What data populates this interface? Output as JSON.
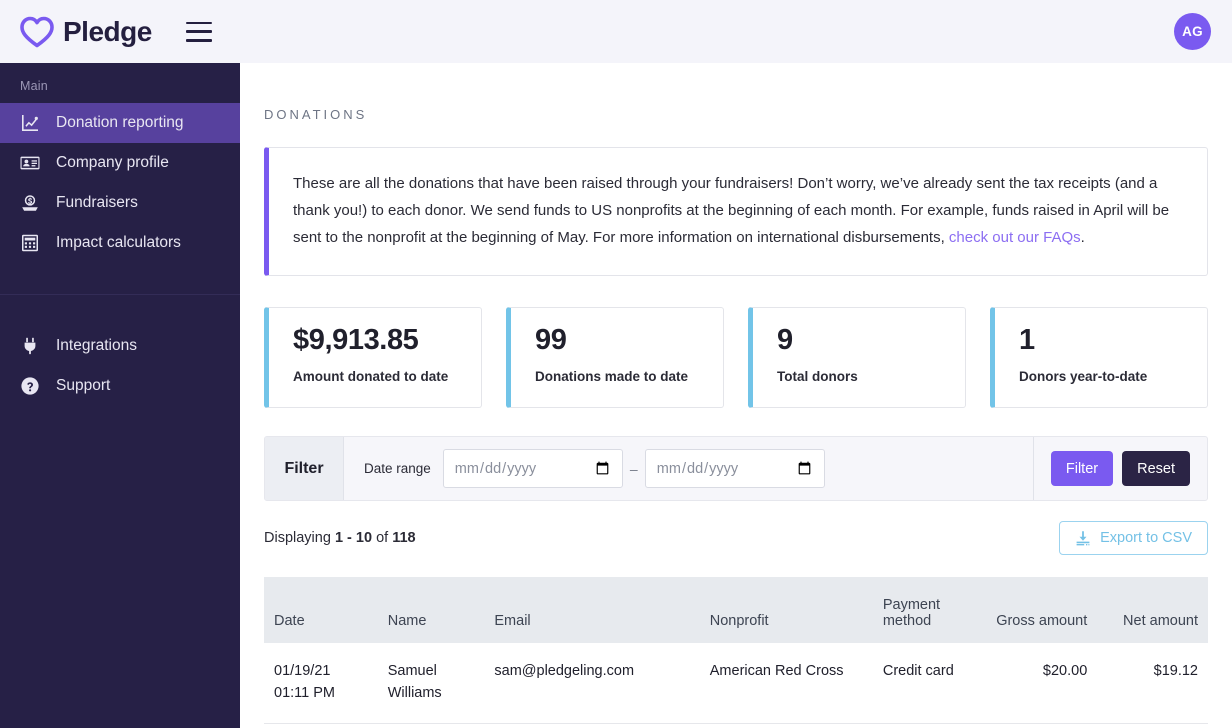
{
  "header": {
    "brand_name": "Pledge",
    "logo_icon": "heart-icon",
    "menu_icon": "hamburger-menu-icon",
    "avatar_initials": "AG"
  },
  "sidebar": {
    "section_label": "Main",
    "items": [
      {
        "label": "Donation reporting",
        "icon": "chart-line-icon",
        "active": true
      },
      {
        "label": "Company profile",
        "icon": "id-card-icon",
        "active": false
      },
      {
        "label": "Fundraisers",
        "icon": "donation-coin-icon",
        "active": false
      },
      {
        "label": "Impact calculators",
        "icon": "calculator-icon",
        "active": false
      }
    ],
    "secondary_items": [
      {
        "label": "Integrations",
        "icon": "plug-icon"
      },
      {
        "label": "Support",
        "icon": "question-circle-icon"
      }
    ]
  },
  "main": {
    "eyebrow": "DONATIONS",
    "banner": {
      "text_before_link": "These are all the donations that have been raised through your fundraisers! Don’t worry, we’ve already sent the tax receipts (and a thank you!) to each donor. We send funds to US nonprofits at the beginning of each month. For example, funds raised in April will be sent to the nonprofit at the beginning of May. For more information on international disbursements, ",
      "link_text": "check out our FAQs",
      "text_after_link": ".",
      "accent_color": "#7a5af0"
    },
    "stats": [
      {
        "value": "$9,913.85",
        "label": "Amount donated to date"
      },
      {
        "value": "99",
        "label": "Donations made to date"
      },
      {
        "value": "9",
        "label": "Total donors"
      },
      {
        "value": "1",
        "label": "Donors year-to-date"
      }
    ],
    "stat_accent_color": "#72c4e8",
    "filter": {
      "legend": "Filter",
      "field_label": "Date range",
      "start_placeholder": "mm/dd/yyyy",
      "start_value": "",
      "end_placeholder": "mm/dd/yyyy",
      "end_value": "",
      "separator": "–",
      "apply_label": "Filter",
      "reset_label": "Reset",
      "apply_color": "#7a5af0",
      "reset_color": "#2b2445"
    },
    "results": {
      "prefix": "Displaying",
      "range": "1 - 10",
      "middle": "of",
      "total": "118",
      "export_label": "Export to CSV",
      "export_icon": "download-icon",
      "export_color": "#74c1e6"
    },
    "table": {
      "columns": [
        "Date",
        "Name",
        "Email",
        "Nonprofit",
        "Payment method",
        "Gross amount",
        "Net amount"
      ],
      "rows": [
        {
          "date_line1": "01/19/21",
          "date_line2": "01:11 PM",
          "name_line1": "Samuel",
          "name_line2": "Williams",
          "email": "sam@pledgeling.com",
          "nonprofit": "American Red Cross",
          "payment_method": "Credit card",
          "gross_amount": "$20.00",
          "net_amount": "$19.12"
        }
      ]
    }
  }
}
